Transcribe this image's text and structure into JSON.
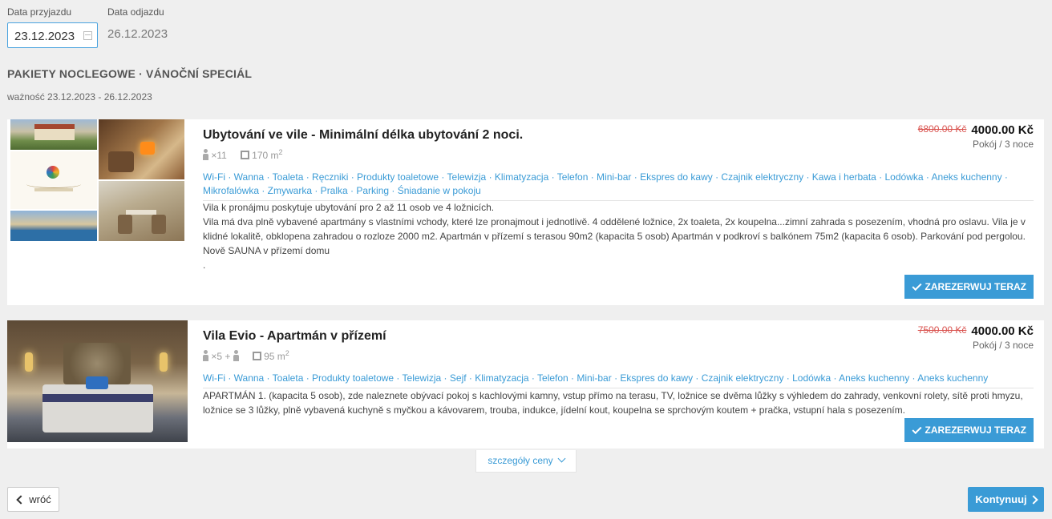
{
  "dates": {
    "arrival_label": "Data przyjazdu",
    "arrival_value": "23.12.2023",
    "departure_label": "Data odjazdu",
    "departure_value": "26.12.2023"
  },
  "package": {
    "title": "PAKIETY NOCLEGOWE · VÁNOČNÍ SPECIÁL",
    "validity": "ważność 23.12.2023 - 26.12.2023"
  },
  "offers": [
    {
      "title": "Ubytování ve vile - Minimální délka ubytování 2 noci.",
      "old_price": "6800.00 Kč",
      "new_price": "4000.00 Kč",
      "per": "Pokój / 3 noce",
      "guests": "×11",
      "area": "170 m",
      "area_unit_sup": "2",
      "amenities": "Wi-Fi · Wanna · Toaleta · Ręczniki · Produkty toaletowe · Telewizja · Klimatyzacja · Telefon · Mini-bar · Ekspres do kawy · Czajnik elektryczny · Kawa i herbata · Lodówka · Aneks kuchenny · Mikrofalówka · Zmywarka · Pralka · Parking · Śniadanie w pokoju",
      "desc_lines": [
        "Vila k pronájmu poskytuje ubytování pro 2 až 11 osob ve 4 ložnicích.",
        "Vila má dva plně vybavené apartmány s vlastními vchody, které lze pronajmout i jednotlivě. 4 oddělené ložnice, 2x toaleta, 2x koupelna...zimní zahrada s posezením, vhodná pro oslavu. Vila je v klidné lokalitě, obklopena zahradou o rozloze 2000 m2. Apartmán v přízemí s terasou 90m2 (kapacita 5 osob) Apartmán v podkroví s balkónem 75m2 (kapacita 6 osob). Parkování pod pergolou.",
        "Nově SAUNA v přízemí domu",
        "."
      ],
      "reserve_label": "ZAREZERWUJ TERAZ"
    },
    {
      "title": "Vila Evio - Apartmán v přízemí",
      "old_price": "7500.00 Kč",
      "new_price": "4000.00 Kč",
      "per": "Pokój / 3 noce",
      "guests": "×5 +",
      "area": "95 m",
      "area_unit_sup": "2",
      "amenities": "Wi-Fi · Wanna · Toaleta · Produkty toaletowe · Telewizja · Sejf · Klimatyzacja · Telefon · Mini-bar · Ekspres do kawy · Czajnik elektryczny · Lodówka · Aneks kuchenny · Aneks kuchenny",
      "desc_lines": [
        "APARTMÁN 1. (kapacita 5 osob), zde naleznete obývací pokoj s kachlovými kamny, vstup přímo na terasu, TV, ložnice se dvěma lůžky s výhledem do zahrady, venkovní rolety, sítě proti hmyzu, ložnice se 3 lůžky, plně vybavená kuchyně s myčkou a kávovarem, trouba, indukce, jídelní kout, koupelna se sprchovým koutem + pračka, vstupní hala s posezením."
      ],
      "reserve_label": "ZAREZERWUJ TERAZ"
    }
  ],
  "details_label": "szczegóły ceny",
  "nav": {
    "back_label": "wróć",
    "next_label": "Kontynuuj"
  },
  "colors": {
    "accent": "#3a9bd6",
    "old_price": "#d9534f",
    "background": "#efefef"
  }
}
